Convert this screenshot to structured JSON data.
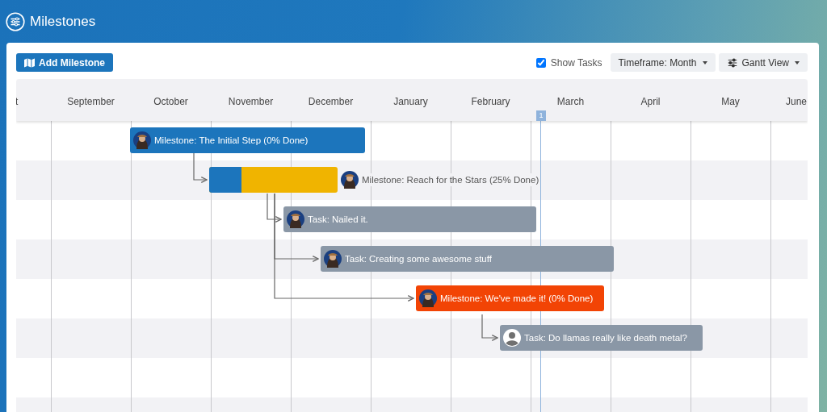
{
  "header": {
    "title": "Milestones"
  },
  "toolbar": {
    "add_button": "Add Milestone",
    "show_tasks": {
      "label": "Show Tasks",
      "checked": true
    },
    "timeframe": "Timeframe: Month",
    "view": "Gantt View"
  },
  "gantt": {
    "months": [
      "t",
      "September",
      "October",
      "November",
      "December",
      "January",
      "February",
      "March",
      "April",
      "May",
      "June"
    ],
    "today_marker": "1",
    "bars": [
      {
        "kind": "milestone",
        "label": "Milestone: The Initial Step (0% Done)",
        "color": "#1c75bc",
        "avatar": {
          "kind": "photo"
        }
      },
      {
        "kind": "progress",
        "label": "Milestone: Reach for the Stars (25% Done)",
        "color": "#f0b400",
        "level": 0.25,
        "avatar": {
          "kind": "photo"
        }
      },
      {
        "kind": "task",
        "label": "Task: Nailed it.",
        "color": "#8a97a6",
        "avatar": {
          "kind": "photo"
        }
      },
      {
        "kind": "task",
        "label": "Task: Creating some awesome stuff",
        "color": "#8a97a6",
        "avatar": {
          "kind": "photo"
        }
      },
      {
        "kind": "milestone",
        "label": "Milestone: We've made it! (0% Done)",
        "color": "#f24405",
        "avatar": {
          "kind": "photo"
        }
      },
      {
        "kind": "task",
        "label": "Task: Do llamas really like death metal?",
        "color": "#8a97a6",
        "avatar": {
          "kind": "placeholder"
        }
      }
    ]
  }
}
